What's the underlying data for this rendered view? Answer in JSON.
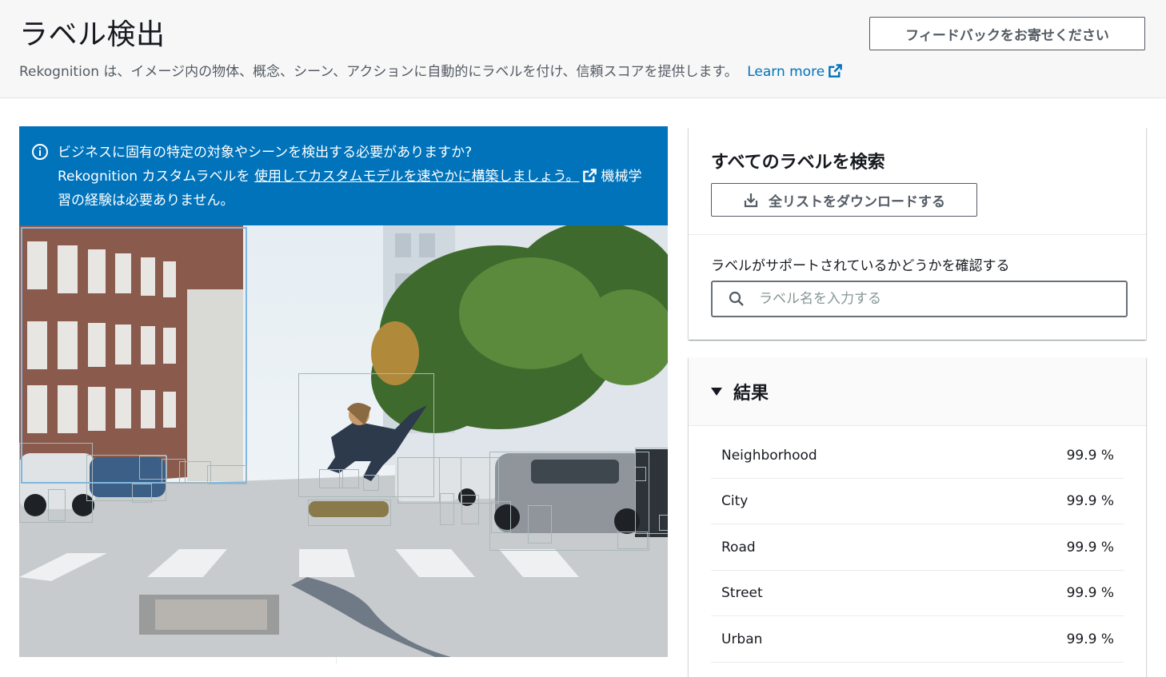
{
  "header": {
    "title": "ラベル検出",
    "description": "Rekognition は、イメージ内の物体、概念、シーン、アクションに自動的にラベルを付け、信頼スコアを提供します。",
    "learn_more": "Learn more",
    "feedback_button": "フィードバックをお寄せください"
  },
  "banner": {
    "line1": "ビジネスに固有の特定の対象やシーンを検出する必要がありますか?",
    "line2_prefix": "Rekognition カスタムラベルを ",
    "link": "使用してカスタムモデルを速やかに構築しましょう。",
    "suffix": "機械学習の経験は必要ありません。"
  },
  "search_panel": {
    "title": "すべてのラベルを検索",
    "download_button": "全リストをダウンロードする",
    "check_label": "ラベルがサポートされているかどうかを確認する",
    "search_placeholder": "ラベル名を入力する"
  },
  "results": {
    "title": "結果",
    "items": [
      {
        "label": "Neighborhood",
        "score": "99.9 %"
      },
      {
        "label": "City",
        "score": "99.9 %"
      },
      {
        "label": "Road",
        "score": "99.9 %"
      },
      {
        "label": "Street",
        "score": "99.9 %"
      },
      {
        "label": "Urban",
        "score": "99.9 %"
      }
    ]
  },
  "colors": {
    "accent": "#0073bb",
    "link": "#0073bb",
    "header_bg": "#f7f7f7"
  }
}
